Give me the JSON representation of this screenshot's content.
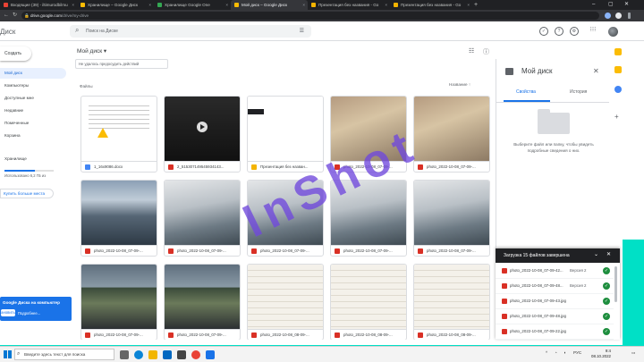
{
  "browser": {
    "tabs": [
      {
        "label": "Входящие (39) - iltimurodbilmu",
        "color": "#ea4335"
      },
      {
        "label": "Хранилище – Google Диск",
        "color": "#fbbc04"
      },
      {
        "label": "Хранилище Google One",
        "color": "#34a853"
      },
      {
        "label": "Мой диск – Google Диск",
        "color": "#fbbc04",
        "active": true
      },
      {
        "label": "Презентация без названия - Go",
        "color": "#f4b400"
      },
      {
        "label": "Презентация без названия - Go",
        "color": "#f4b400"
      }
    ],
    "url_host": "drive.google.com",
    "url_path": "/drive/my-drive"
  },
  "header": {
    "logo_text": "Диск",
    "search_placeholder": "Поиск на Диске"
  },
  "sidebar": {
    "create_label": "Создать",
    "items": [
      {
        "label": "Мой диск",
        "active": true
      },
      {
        "label": "Компьютеры"
      },
      {
        "label": "Доступные мне"
      },
      {
        "label": "Недавние"
      },
      {
        "label": "Помеченные"
      },
      {
        "label": "Корзина"
      },
      {
        "label": "Хранилище"
      }
    ],
    "storage_used": 0.62,
    "storage_text": "Использовано 6,2 ГБ из",
    "buy_label": "Купить больше места"
  },
  "promo": {
    "title": "Google Диска на компьютер",
    "install": "ановить",
    "more": "Подробнее..."
  },
  "main": {
    "breadcrumb": "Мой диск",
    "toast": "Не удалось предосудить действий",
    "section_label": "Файлы",
    "sort_label": "Название",
    "files": [
      {
        "name": "1_16x9086.docx",
        "type": "doc",
        "thumb": "doc"
      },
      {
        "name": "2_515307149545934143...",
        "type": "vid",
        "thumb": "video"
      },
      {
        "name": "Презентация без назван...",
        "type": "slide",
        "thumb": "slide"
      },
      {
        "name": "photo_2022-10-08_07-09-...",
        "type": "img",
        "thumb": "photo"
      },
      {
        "name": "photo_2022-10-08_07-09-...",
        "type": "img",
        "thumb": "photo"
      },
      {
        "name": "photo_2022-10-08_07-09-...",
        "type": "img",
        "thumb": "hall"
      },
      {
        "name": "photo_2022-10-08_07-09-...",
        "type": "img",
        "thumb": "room"
      },
      {
        "name": "photo_2022-10-08_07-09-...",
        "type": "img",
        "thumb": "room"
      },
      {
        "name": "photo_2022-10-08_07-09-...",
        "type": "img",
        "thumb": "room"
      },
      {
        "name": "photo_2022-10-08_07-09-...",
        "type": "img",
        "thumb": "room"
      },
      {
        "name": "photo_2022-10-08_07-09-...",
        "type": "img",
        "thumb": "class"
      },
      {
        "name": "photo_2022-10-08_07-09-...",
        "type": "img",
        "thumb": "class"
      },
      {
        "name": "photo_2022-10-08_08-09-...",
        "type": "img",
        "thumb": "paper"
      },
      {
        "name": "photo_2022-10-08_08-09-...",
        "type": "img",
        "thumb": "paper"
      },
      {
        "name": "photo_2022-10-08_08-09-...",
        "type": "img",
        "thumb": "paper"
      }
    ]
  },
  "details": {
    "title": "Мой диск",
    "tab_properties": "Свойства",
    "tab_history": "История",
    "hint": "Выберите файл или папку, чтобы увидеть подробные сведения о них."
  },
  "upload": {
    "title": "Загрузка 15 файлов завершена",
    "rows": [
      {
        "name": "photo_2022-10-08_07-09-42...",
        "note": "Версия 2"
      },
      {
        "name": "photo_2022-10-08_07-09-48...",
        "note": "Версия 2"
      },
      {
        "name": "photo_2022-10-08_07-09-43.jpg",
        "note": ""
      },
      {
        "name": "photo_2022-10-08_07-09-48.jpg",
        "note": ""
      },
      {
        "name": "photo_2022-10-08_07-09-22.jpg",
        "note": ""
      }
    ]
  },
  "taskbar": {
    "search_placeholder": "Введите здесь текст для поиска",
    "lang": "РУС",
    "time": "9:4",
    "date": "08.10.2022"
  },
  "watermark": {
    "text": "InShot"
  },
  "colors": {
    "accent": "#1a73e8",
    "active_bg": "#e8f0fe",
    "success": "#1e8e3e",
    "watermark": "#7048dc",
    "teal": "#00e0c6"
  }
}
